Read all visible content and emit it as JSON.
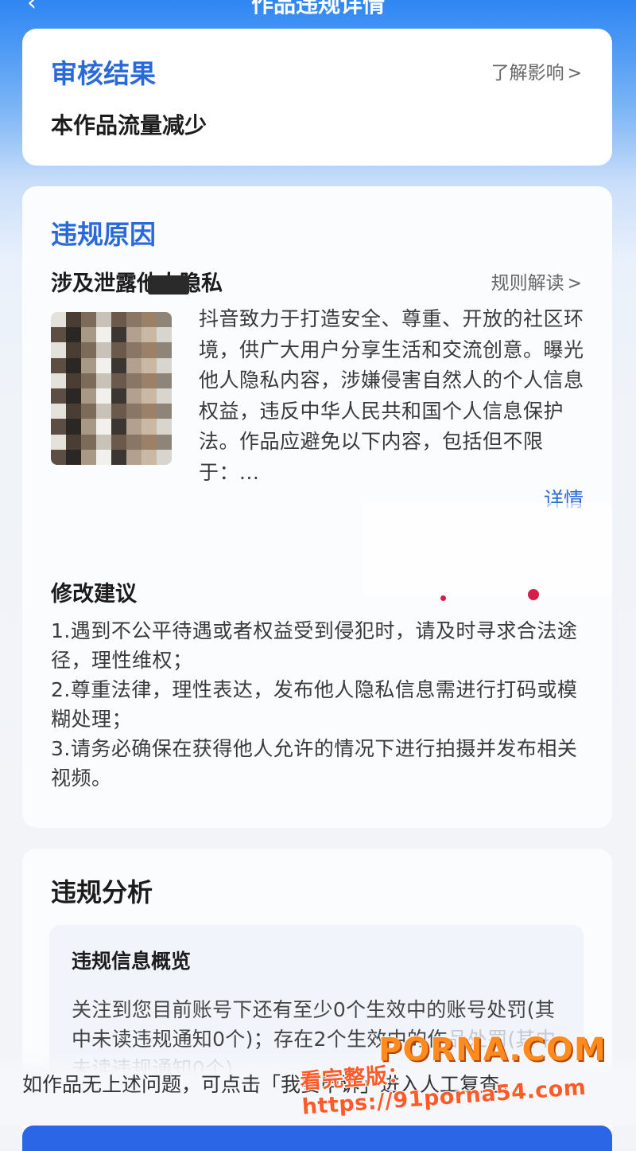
{
  "header": {
    "title": "作品违规详情",
    "right_label": ""
  },
  "result": {
    "title": "审核结果",
    "link": "了解影响",
    "text": "本作品流量减少"
  },
  "reason": {
    "title": "违规原因",
    "subtitle": "涉及泄露他人隐私",
    "link": "规则解读",
    "body": "抖音致力于打造安全、尊重、开放的社区环境，供广大用户分享生活和交流创意。曝光他人隐私内容，涉嫌侵害自然人的个人信息权益，违反中华人民共和国个人信息保护法。作品应避免以下内容，包括但不限于：...",
    "detail_link": "详情"
  },
  "suggestion": {
    "title": "修改建议",
    "items": [
      "1.遇到不公平待遇或者权益受到侵犯时，请及时寻求合法途径，理性维权；",
      "2.尊重法律，理性表达，发布他人隐私信息需进行打码或模糊处理；",
      "3.请务必确保在获得他人允许的情况下进行拍摄并发布相关视频。"
    ]
  },
  "analysis": {
    "title": "违规分析",
    "overview_title": "违规信息概览",
    "overview_text": "关注到您目前账号下还有至少0个生效中的账号处罚(其中未读违规通知0个)；存在2个生效中的作",
    "overview_text_faded": "品处罚(其中未读违规通知0个)"
  },
  "footer": {
    "note": "如作品无上述问题，可点击「我要申诉」进入人工复查。"
  },
  "watermark": {
    "brand": "PORNA.COM",
    "url": "看完整版：https://91porna54.com"
  },
  "colors": {
    "accent": "#2a69d9",
    "header_blue": "#2f86f2",
    "button_blue": "#2a66e6"
  }
}
